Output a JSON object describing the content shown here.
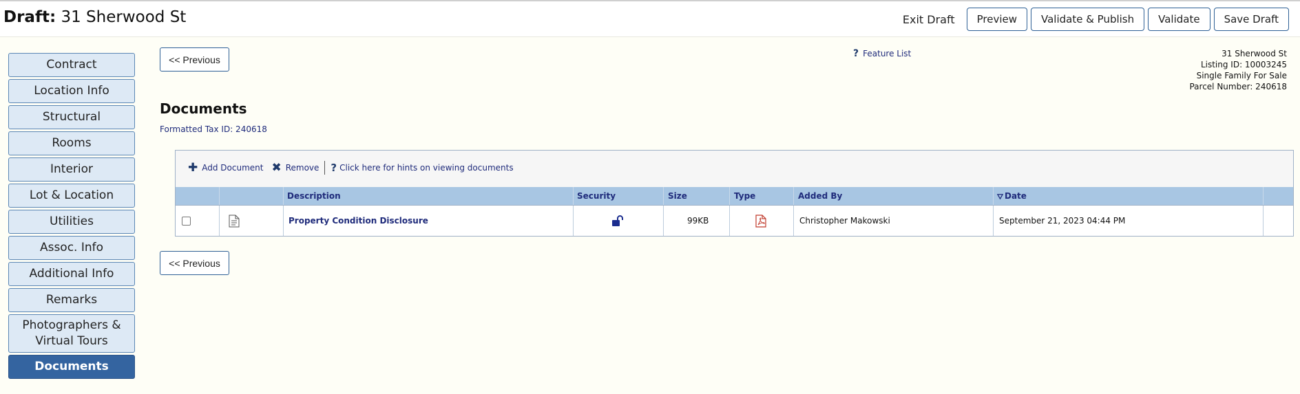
{
  "header": {
    "title_prefix": "Draft:",
    "title": "31 Sherwood St",
    "exit_label": "Exit Draft",
    "buttons": [
      "Preview",
      "Validate & Publish",
      "Validate",
      "Save Draft"
    ]
  },
  "sidebar": {
    "items": [
      {
        "label": "Contract"
      },
      {
        "label": "Location Info"
      },
      {
        "label": "Structural"
      },
      {
        "label": "Rooms"
      },
      {
        "label": "Interior"
      },
      {
        "label": "Lot & Location"
      },
      {
        "label": "Utilities"
      },
      {
        "label": "Assoc. Info"
      },
      {
        "label": "Additional Info"
      },
      {
        "label": "Remarks"
      },
      {
        "label": "Photographers & Virtual Tours"
      },
      {
        "label": "Documents",
        "active": true
      }
    ]
  },
  "nav": {
    "previous_label": "<< Previous"
  },
  "feature_list": {
    "label": "Feature List"
  },
  "listing": {
    "address": "31 Sherwood St",
    "listing_id": "Listing ID: 10003245",
    "type": "Single Family For Sale",
    "parcel": "Parcel Number: 240618"
  },
  "page": {
    "heading": "Documents",
    "tax_id": "Formatted Tax ID: 240618"
  },
  "toolbar": {
    "add_label": "Add Document",
    "remove_label": "Remove",
    "hints_label": "Click here for hints on viewing documents"
  },
  "table": {
    "columns": {
      "description": "Description",
      "security": "Security",
      "size": "Size",
      "type": "Type",
      "added_by": "Added By",
      "date": "Date"
    },
    "rows": [
      {
        "description": "Property Condition Disclosure",
        "size": "99KB",
        "added_by": "Christopher Makowski",
        "date": "September 21, 2023 04:44 PM",
        "security_icon": "unlocked-padlock-icon",
        "type_icon": "pdf-icon"
      }
    ]
  },
  "colors": {
    "accent": "#3464a0",
    "nav_bg": "#dde9f5",
    "table_header": "#a8c6e3",
    "link": "#1f2b7b",
    "pdf": "#c0392b"
  }
}
